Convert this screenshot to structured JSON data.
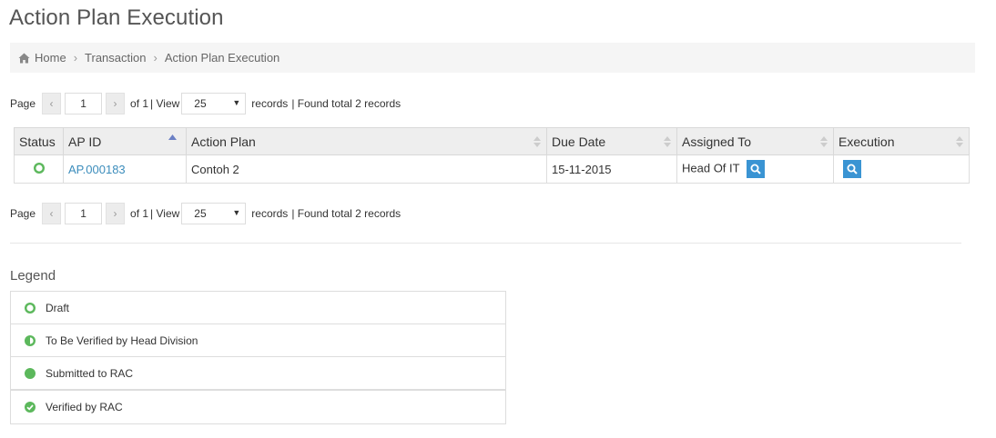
{
  "page": {
    "title": "Action Plan Execution"
  },
  "breadcrumb": {
    "items": [
      "Home",
      "Transaction",
      "Action Plan Execution"
    ]
  },
  "pager": {
    "page_label": "Page",
    "current_page": "1",
    "of_label": "of 1",
    "view_label": "| View",
    "per_page": "25",
    "records_label": "records",
    "found_label": "| Found total 2 records"
  },
  "grid": {
    "columns": [
      "Status",
      "AP ID",
      "Action Plan",
      "Due Date",
      "Assigned To",
      "Execution"
    ],
    "rows": [
      {
        "status": "Draft",
        "ap_id": "AP.000183",
        "action_plan": "Contoh 2",
        "due_date": "15-11-2015",
        "assigned_to": "Head Of IT"
      }
    ]
  },
  "legend": {
    "title": "Legend",
    "items": [
      "Draft",
      "To Be Verified by Head Division",
      "Submitted to RAC",
      "Verified by RAC"
    ]
  },
  "colors": {
    "accent": "#3a94d3",
    "status_green": "#5cb85c",
    "link": "#3c8dbc"
  },
  "icons": {
    "home": "home-icon",
    "search": "search-icon",
    "sort": "sort-icon"
  }
}
